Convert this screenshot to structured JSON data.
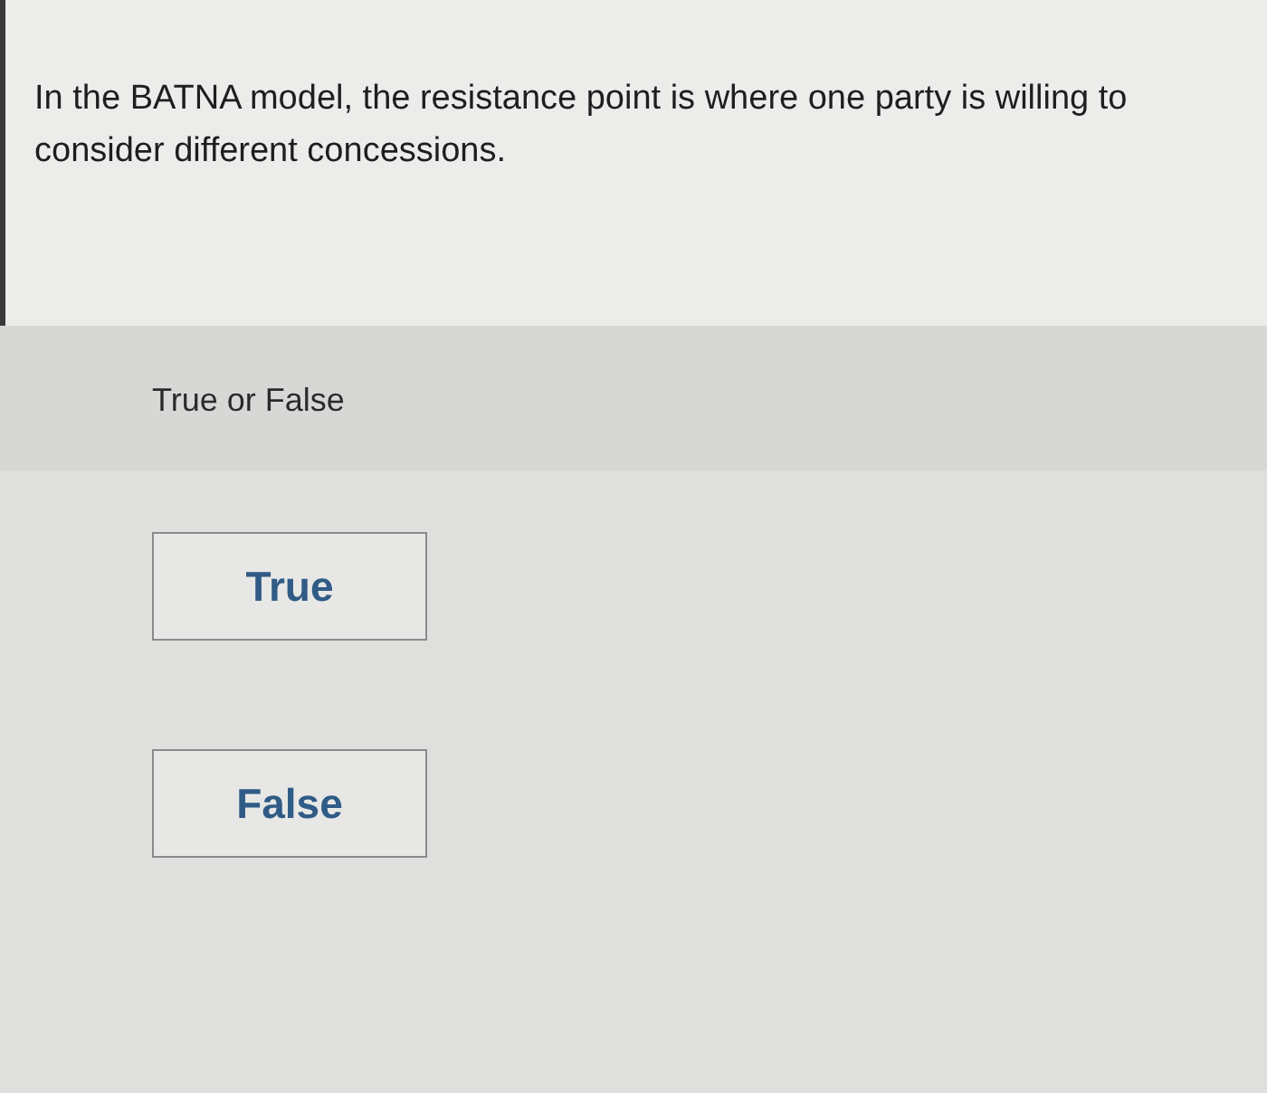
{
  "question": "In the BATNA model, the resistance point is where one party is willing to consider different concessions.",
  "prompt": "True or False",
  "options": [
    {
      "label": "True"
    },
    {
      "label": "False"
    }
  ]
}
